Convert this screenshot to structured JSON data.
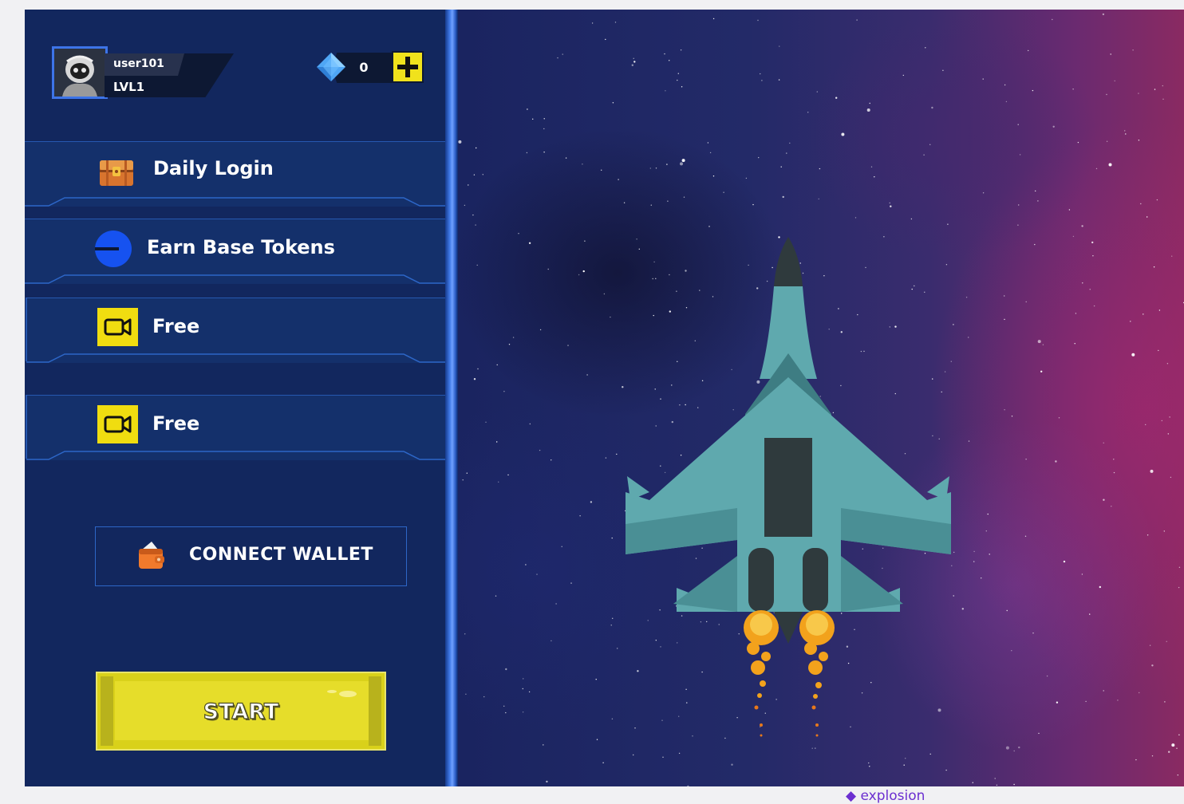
{
  "profile": {
    "username": "user101",
    "level": "LVL1"
  },
  "currency": {
    "gems": "0",
    "add_icon": "plus-icon"
  },
  "menu": {
    "daily_login": {
      "label": "Daily Login",
      "icon": "treasure-chest-icon"
    },
    "earn_tokens": {
      "label": "Earn Base Tokens",
      "icon": "base-token-icon"
    },
    "free_1": {
      "label": "Free",
      "icon": "video-camera-icon"
    },
    "free_2": {
      "label": "Free",
      "icon": "video-camera-icon"
    }
  },
  "wallet": {
    "label": "CONNECT WALLET",
    "icon": "wallet-icon"
  },
  "start": {
    "label": "START"
  },
  "footer": {
    "brand": "explosion"
  },
  "colors": {
    "panel": "#12275e",
    "accent_blue": "#3d74e8",
    "start_yellow": "#e6dd2a",
    "token_blue": "#1652f0",
    "jet": "#5fa9ae"
  }
}
